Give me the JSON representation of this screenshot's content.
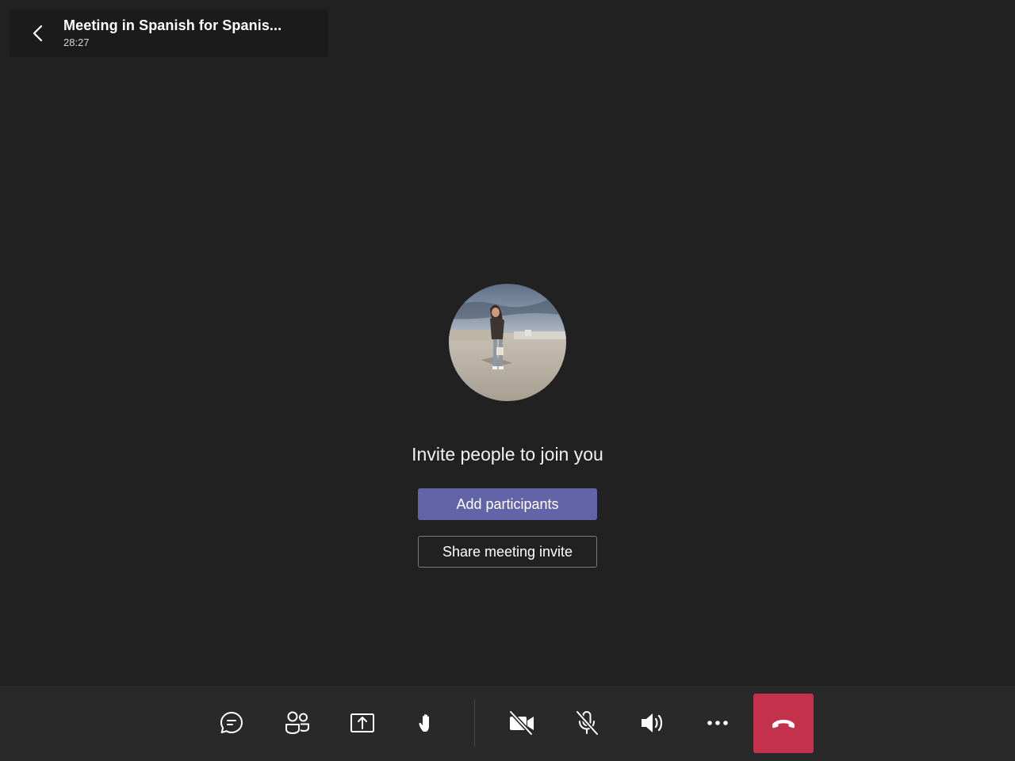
{
  "meeting": {
    "title": "Meeting in Spanish for Spanis...",
    "timer": "28:27"
  },
  "main": {
    "invite_text": "Invite people to join you",
    "add_participants_label": "Add participants",
    "share_invite_label": "Share meeting invite"
  },
  "toolbar": {
    "items": [
      {
        "name": "chat",
        "icon": "chat-icon"
      },
      {
        "name": "participants",
        "icon": "people-icon"
      },
      {
        "name": "share",
        "icon": "share-screen-icon"
      },
      {
        "name": "raise-hand",
        "icon": "hand-icon"
      },
      {
        "name": "camera",
        "icon": "camera-off-icon",
        "state": "off"
      },
      {
        "name": "microphone",
        "icon": "mic-off-icon",
        "state": "muted"
      },
      {
        "name": "speaker",
        "icon": "speaker-icon",
        "state": "on"
      },
      {
        "name": "more",
        "icon": "more-icon"
      },
      {
        "name": "hang-up",
        "icon": "hang-up-icon"
      }
    ]
  },
  "colors": {
    "background": "#212121",
    "toolbar": "#292929",
    "accent": "#6264a7",
    "hangup": "#c4314b"
  }
}
